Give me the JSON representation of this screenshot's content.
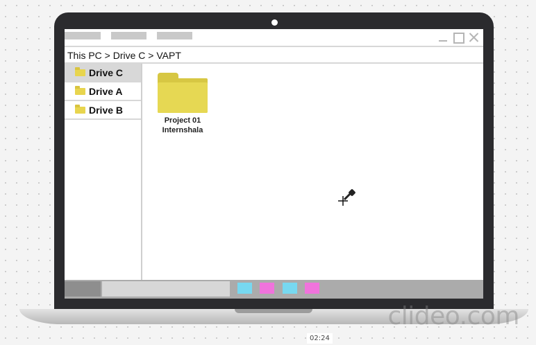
{
  "window": {
    "breadcrumb": "This PC > Drive C > VAPT",
    "controls": [
      "minimize-icon",
      "maximize-icon",
      "close-icon"
    ]
  },
  "sidebar": {
    "items": [
      {
        "label": "Drive C",
        "active": true
      },
      {
        "label": "Drive A",
        "active": false
      },
      {
        "label": "Drive B",
        "active": false
      }
    ]
  },
  "content": {
    "folders": [
      {
        "name": "Project 01\nInternshala",
        "color": "#e6d853"
      }
    ]
  },
  "taskbar": {
    "app_colors": [
      "#77d8f0",
      "#f073dc",
      "#77d8f0",
      "#f073dc"
    ]
  },
  "overlay": {
    "watermark": "clideo.com",
    "timestamp": "02:24"
  },
  "colors": {
    "laptop_frame": "#2b2b2e",
    "folder_yellow": "#e6d853",
    "sidebar_active": "#d8d8d8"
  }
}
